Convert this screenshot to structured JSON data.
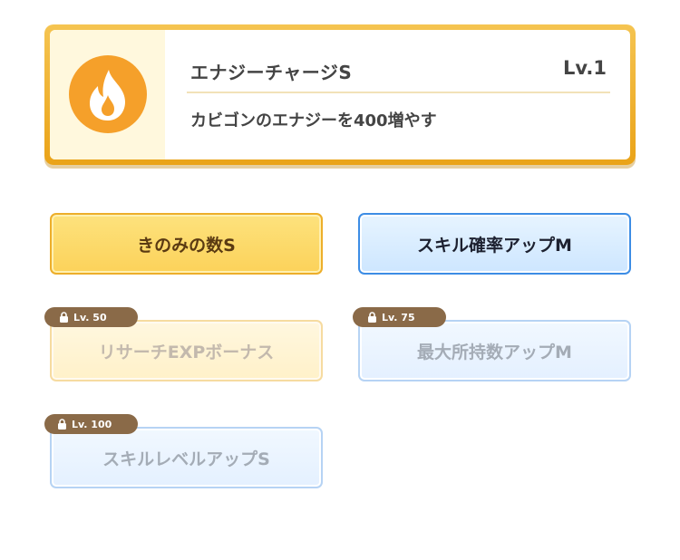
{
  "skill": {
    "name": "エナジーチャージS",
    "level": "Lv.1",
    "description": "カビゴンのエナジーを400増やす",
    "icon": "flame-icon",
    "accent_color": "#f5a02a"
  },
  "subskills": [
    {
      "label": "きのみの数S",
      "color": "yellow",
      "unlocked": true
    },
    {
      "label": "スキル確率アップM",
      "color": "blue",
      "unlocked": true
    },
    {
      "label": "リサーチEXPボーナス",
      "color": "yellow",
      "unlocked": false,
      "unlock_level": "Lv. 50"
    },
    {
      "label": "最大所持数アップM",
      "color": "blue",
      "unlocked": false,
      "unlock_level": "Lv. 75"
    },
    {
      "label": "スキルレベルアップS",
      "color": "blue",
      "unlocked": false,
      "unlock_level": "Lv. 100"
    }
  ]
}
